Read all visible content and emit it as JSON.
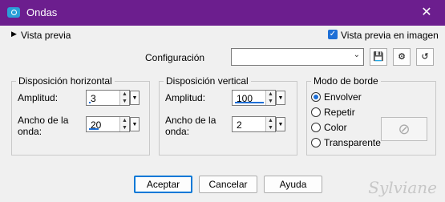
{
  "window": {
    "title": "Ondas"
  },
  "preview": {
    "toggle_label": "Vista previa",
    "checkbox_label": "Vista previa en imagen",
    "checked": true
  },
  "config": {
    "label": "Configuración",
    "value": ""
  },
  "horizontal": {
    "title": "Disposición horizontal",
    "amplitude_label": "Amplitud:",
    "amplitude_value": "3",
    "wavelength_label_1": "Ancho de la",
    "wavelength_label_2": "onda:",
    "wavelength_value": "20"
  },
  "vertical": {
    "title": "Disposición vertical",
    "amplitude_label": "Amplitud:",
    "amplitude_value": "100",
    "wavelength_label_1": "Ancho de la",
    "wavelength_label_2": "onda:",
    "wavelength_value": "2"
  },
  "edge": {
    "title": "Modo de borde",
    "options": [
      "Envolver",
      "Repetir",
      "Color",
      "Transparente"
    ],
    "selected": "Envolver"
  },
  "buttons": {
    "accept": "Aceptar",
    "cancel": "Cancelar",
    "help": "Ayuda"
  },
  "watermark": "Sylviane"
}
